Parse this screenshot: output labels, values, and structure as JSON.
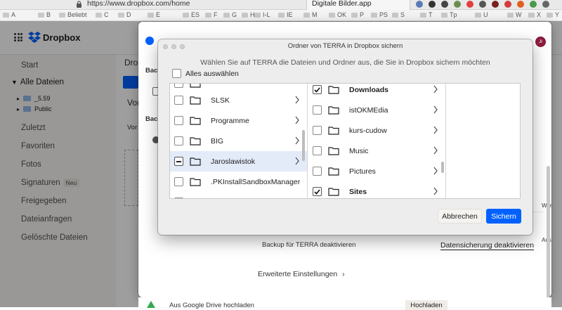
{
  "browser": {
    "url": "https://www.dropbox.com/home",
    "tab_title": "Digitale Bilder.app",
    "bookmarks": [
      "A",
      "B",
      "Beliebt",
      "C",
      "D",
      "E",
      "ES",
      "F",
      "G",
      "H",
      "I-L",
      "IE",
      "M",
      "OK",
      "P",
      "PS",
      "S",
      "T",
      "Tp",
      "U",
      "W",
      "X",
      "Y"
    ]
  },
  "header": {
    "brand": "Dropbox",
    "avatar_initials": "JI"
  },
  "sidebar": {
    "items": [
      {
        "label": "Start"
      },
      {
        "label": "Alle Dateien"
      },
      {
        "label": "Zuletzt"
      },
      {
        "label": "Favoriten"
      },
      {
        "label": "Fotos"
      },
      {
        "label": "Signaturen",
        "badge": "Neu"
      },
      {
        "label": "Freigegeben"
      },
      {
        "label": "Dateianfragen"
      },
      {
        "label": "Gelöschte Dateien"
      }
    ],
    "tree": [
      {
        "label": "_5.59"
      },
      {
        "label": "Public"
      }
    ]
  },
  "main_partial": {
    "title_fragment": "Drop",
    "vor": "Vor",
    "vor2": "Vor"
  },
  "settings_window": {
    "logo_fragment": "Dropbox",
    "backup_label_1": "Back",
    "backup_label_2": "Back",
    "backup_status": "Backup für TERRA deaktivieren",
    "backup_action": "Datensicherung deaktivieren",
    "advanced": "Erweiterte Einstellungen",
    "side_fragment": "Wer",
    "side_fragment_2": "Aus",
    "bottom_text": "Aus Google Drive hochladen",
    "bottom_button": "Hochladen"
  },
  "dialog": {
    "title": "Ordner von TERRA in Dropbox sichern",
    "subtitle": "Wählen Sie auf TERRA die Dateien und Ordner aus, die Sie in Dropbox sichern möchten",
    "select_all": "Alles auswählen",
    "column1": [
      {
        "label": "",
        "state": "unchecked",
        "partial": true
      },
      {
        "label": "SLSK",
        "state": "unchecked"
      },
      {
        "label": "Programme",
        "state": "unchecked"
      },
      {
        "label": "BIG",
        "state": "unchecked"
      },
      {
        "label": "Jaroslawistok",
        "state": "mixed",
        "selected": true
      },
      {
        "label": ".PKInstallSandboxManager",
        "state": "unchecked"
      },
      {
        "label": "",
        "state": "unchecked",
        "partial": true
      }
    ],
    "column2": [
      {
        "label": "Downloads",
        "state": "checked"
      },
      {
        "label": "istOKMEdia",
        "state": "unchecked"
      },
      {
        "label": "kurs-cudow",
        "state": "unchecked"
      },
      {
        "label": "Music",
        "state": "unchecked"
      },
      {
        "label": "Pictures",
        "state": "unchecked"
      },
      {
        "label": "Sites",
        "state": "checked"
      }
    ],
    "cancel": "Abbrechen",
    "save": "Sichern"
  },
  "colors": {
    "accent": "#0061fe",
    "selected_row": "#e3eaf8",
    "sidebar_bg": "#f7f5f2"
  }
}
